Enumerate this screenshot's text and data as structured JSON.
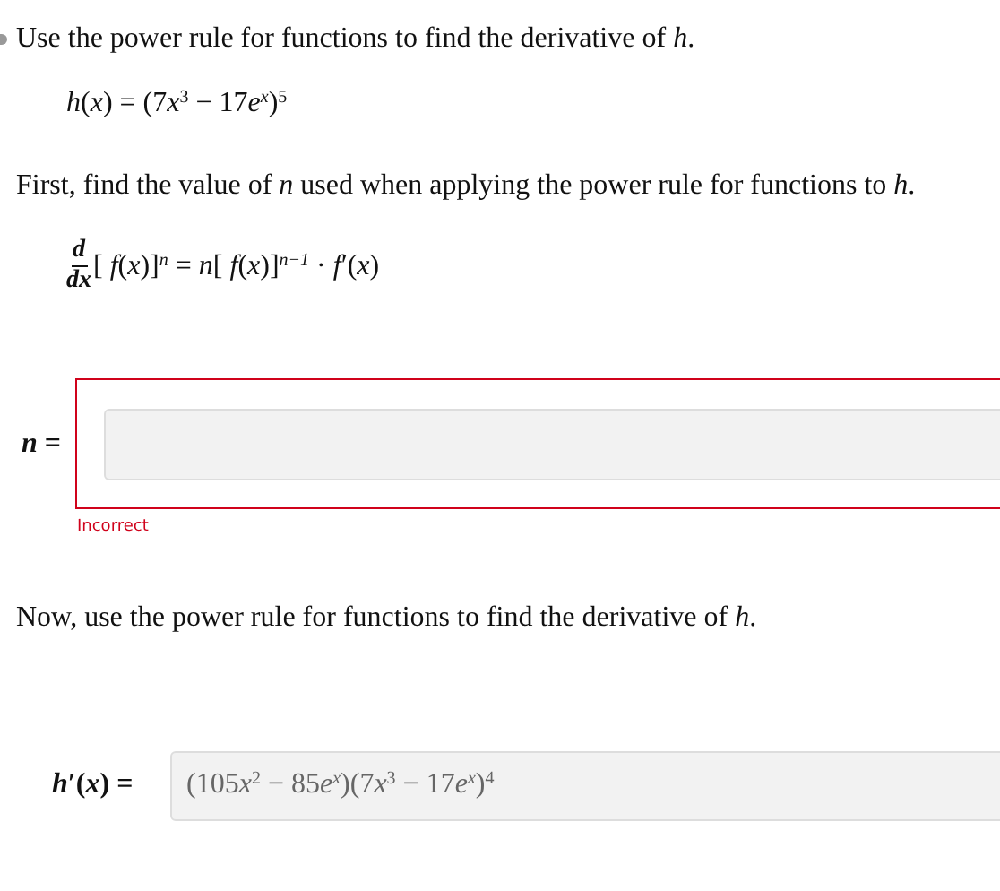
{
  "prompt": "Use the power rule for functions to find the derivative of *h*.",
  "function": [
    {
      "kind": "italic",
      "text": "h"
    },
    {
      "kind": "normal",
      "text": "("
    },
    {
      "kind": "italic",
      "text": "x"
    },
    {
      "kind": "normal",
      "text": ") = (7"
    },
    {
      "kind": "italic",
      "text": "x"
    },
    {
      "kind": "sup",
      "text": "3"
    },
    {
      "kind": "normal",
      "text": " − 17"
    },
    {
      "kind": "italic",
      "text": "e"
    },
    {
      "kind": "sup_italic",
      "text": "x"
    },
    {
      "kind": "normal",
      "text": ")"
    },
    {
      "kind": "sup",
      "text": "5"
    }
  ],
  "step_instruction": "First, find the value of *n* used when applying the power rule for functions to *h*.",
  "rule": {
    "numerator": "d",
    "denominator": "dx",
    "rhs": [
      {
        "kind": "normal",
        "text": "[ "
      },
      {
        "kind": "italic",
        "text": "f"
      },
      {
        "kind": "normal",
        "text": "("
      },
      {
        "kind": "italic",
        "text": "x"
      },
      {
        "kind": "normal",
        "text": ")]"
      },
      {
        "kind": "sup_italic",
        "text": "n"
      },
      {
        "kind": "normal",
        "text": " = "
      },
      {
        "kind": "italic",
        "text": "n"
      },
      {
        "kind": "normal",
        "text": "[ "
      },
      {
        "kind": "italic",
        "text": "f"
      },
      {
        "kind": "normal",
        "text": "("
      },
      {
        "kind": "italic",
        "text": "x"
      },
      {
        "kind": "normal",
        "text": ")]"
      },
      {
        "kind": "sup_italic",
        "text": "n−1"
      },
      {
        "kind": "normal",
        "text": " · "
      },
      {
        "kind": "italic",
        "text": "f"
      },
      {
        "kind": "normal",
        "text": "′("
      },
      {
        "kind": "italic",
        "text": "x"
      },
      {
        "kind": "normal",
        "text": ")"
      }
    ]
  },
  "n_answer": {
    "label": "*n* =",
    "incorrect": true,
    "feedback": "Incorrect"
  },
  "next_instruction": "Now, use the power rule for functions to find the derivative of *h*.",
  "derivative_answer": {
    "label": "*h*′(*x*) =",
    "value": [
      {
        "kind": "normal",
        "text": "(105"
      },
      {
        "kind": "italic",
        "text": "x"
      },
      {
        "kind": "sup",
        "text": "2"
      },
      {
        "kind": "normal",
        "text": " − 85"
      },
      {
        "kind": "italic",
        "text": "e"
      },
      {
        "kind": "sup_italic",
        "text": "x"
      },
      {
        "kind": "normal",
        "text": ")(7"
      },
      {
        "kind": "italic",
        "text": "x"
      },
      {
        "kind": "sup",
        "text": "3"
      },
      {
        "kind": "normal",
        "text": " − 17"
      },
      {
        "kind": "italic",
        "text": "e"
      },
      {
        "kind": "sup_italic",
        "text": "x"
      },
      {
        "kind": "normal",
        "text": ")"
      },
      {
        "kind": "sup",
        "text": "4"
      }
    ]
  }
}
